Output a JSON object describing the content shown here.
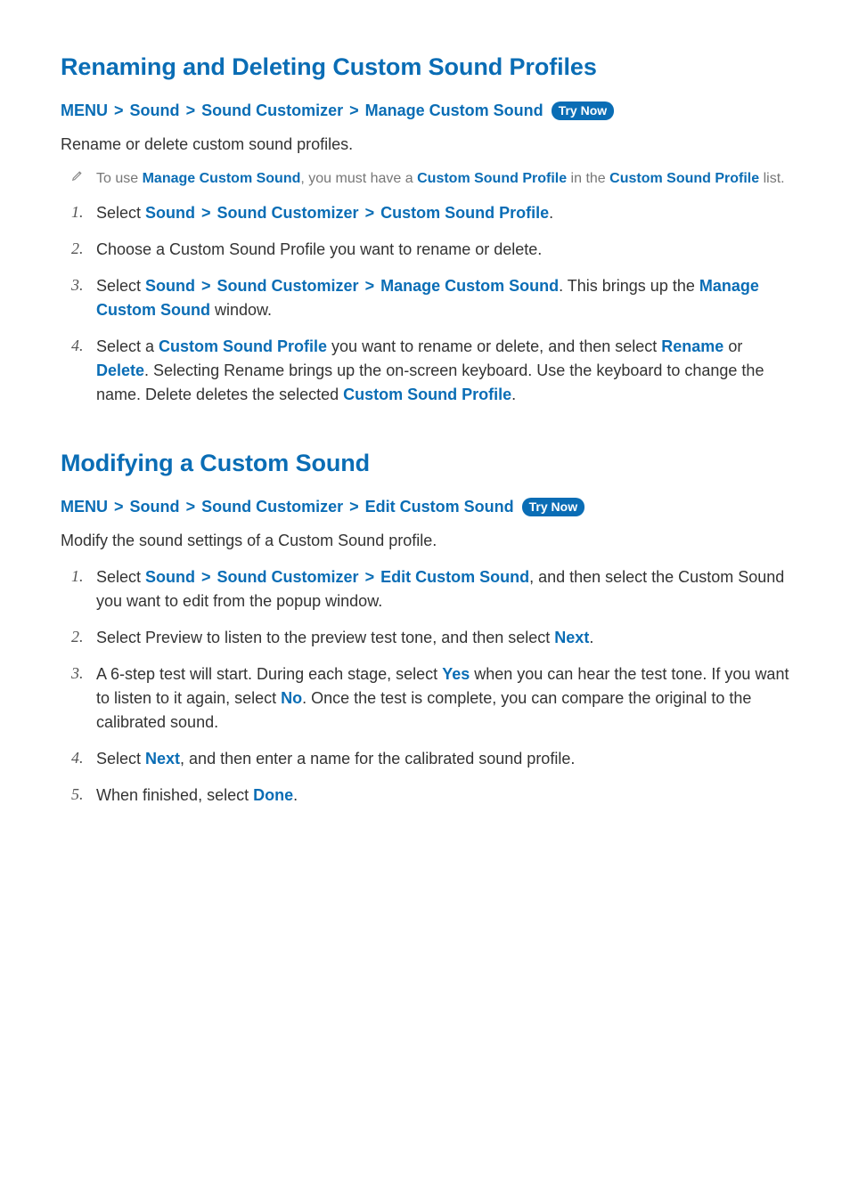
{
  "section1": {
    "title": "Renaming and Deleting Custom Sound Profiles",
    "breadcrumb": {
      "menu": "MENU",
      "sound": "Sound",
      "customizer": "Sound Customizer",
      "target": "Manage Custom Sound",
      "try_now": "Try Now"
    },
    "intro": "Rename or delete custom sound profiles.",
    "note": {
      "pre": "To use ",
      "mcs": "Manage Custom Sound",
      "mid": ", you must have a ",
      "csp1": "Custom Sound Profile",
      "mid2": " in the ",
      "csp2": "Custom Sound Profile",
      "tail": " list."
    },
    "steps": {
      "n1": "1.",
      "n2": "2.",
      "n3": "3.",
      "n4": "4.",
      "s1_pre": "Select ",
      "s1_sound": "Sound",
      "s1_sc": "Sound Customizer",
      "s1_csp": "Custom Sound Profile",
      "s1_tail": ".",
      "s2": "Choose a Custom Sound Profile you want to rename or delete.",
      "s3_pre": "Select ",
      "s3_sound": "Sound",
      "s3_sc": "Sound Customizer",
      "s3_mcs": "Manage Custom Sound",
      "s3_mid": ". This brings up the ",
      "s3_mcs2": "Manage Custom Sound",
      "s3_tail": " window.",
      "s4_pre": "Select a ",
      "s4_csp": "Custom Sound Profile",
      "s4_mid": " you want to rename or delete, and then select ",
      "s4_rename": "Rename",
      "s4_or": " or ",
      "s4_delete": "Delete",
      "s4_mid2": ". Selecting Rename brings up the on-screen keyboard. Use the keyboard to change the name. Delete deletes the selected ",
      "s4_csp2": "Custom Sound Profile",
      "s4_tail": "."
    }
  },
  "section2": {
    "title": "Modifying a Custom Sound",
    "breadcrumb": {
      "menu": "MENU",
      "sound": "Sound",
      "customizer": "Sound Customizer",
      "target": "Edit Custom Sound",
      "try_now": "Try Now"
    },
    "intro": "Modify the sound settings of a Custom Sound profile.",
    "steps": {
      "n1": "1.",
      "n2": "2.",
      "n3": "3.",
      "n4": "4.",
      "n5": "5.",
      "s1_pre": "Select ",
      "s1_sound": "Sound",
      "s1_sc": "Sound Customizer",
      "s1_ecs": "Edit Custom Sound",
      "s1_tail": ", and then select the Custom Sound you want to edit from the popup window.",
      "s2_pre": "Select Preview to listen to the preview test tone, and then select ",
      "s2_next": "Next",
      "s2_tail": ".",
      "s3_pre": "A 6-step test will start. During each stage, select ",
      "s3_yes": "Yes",
      "s3_mid": " when you can hear the test tone. If you want to listen to it again, select ",
      "s3_no": "No",
      "s3_tail": ". Once the test is complete, you can compare the original to the calibrated sound.",
      "s4_pre": "Select ",
      "s4_next": "Next",
      "s4_tail": ", and then enter a name for the calibrated sound profile.",
      "s5_pre": "When finished, select ",
      "s5_done": "Done",
      "s5_tail": "."
    }
  }
}
